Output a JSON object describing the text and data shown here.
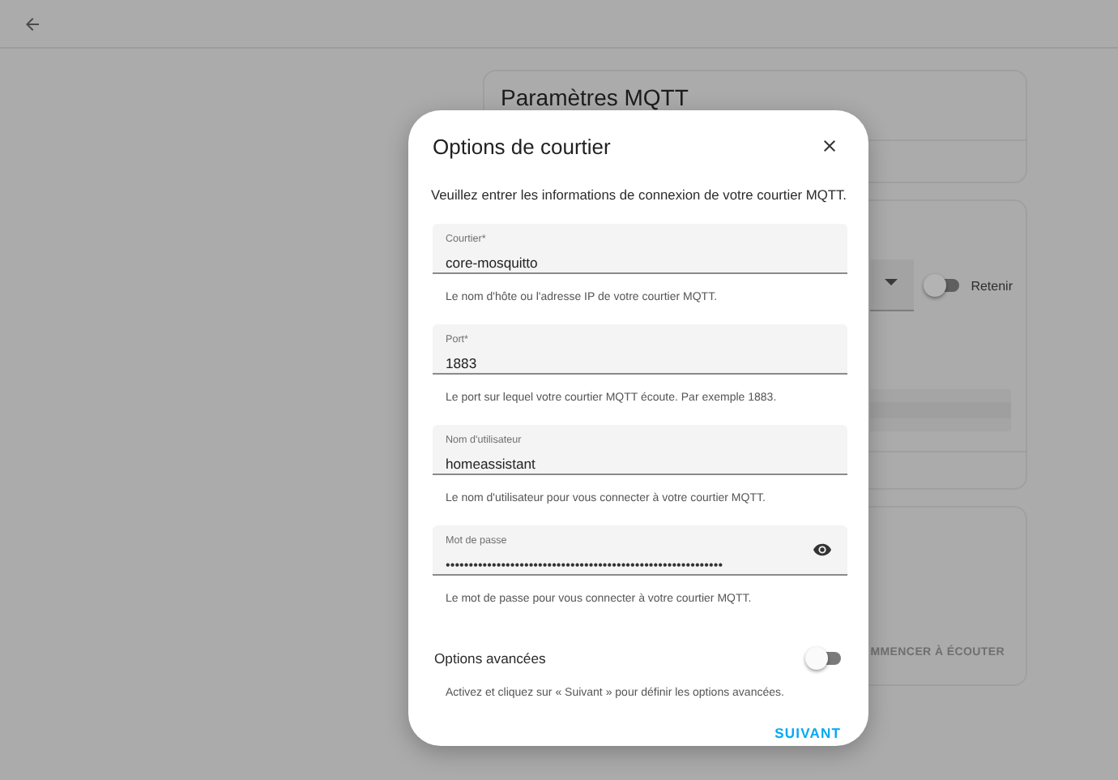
{
  "background": {
    "cards": [
      {
        "kind": "title",
        "title": "Paramètres MQTT"
      },
      {
        "kind": "listen_form",
        "toggle_label": "Retenir",
        "toggle_on": false
      },
      {
        "kind": "action",
        "button": "MMENCER À ÉCOUTER"
      }
    ]
  },
  "dialog": {
    "title": "Options de courtier",
    "description": "Veuillez entrer les informations de connexion de votre courtier MQTT.",
    "fields": [
      {
        "kind": "text",
        "label": "Courtier*",
        "value": "core-mosquitto",
        "helper": "Le nom d'hôte ou l'adresse IP de votre courtier MQTT."
      },
      {
        "kind": "text",
        "label": "Port*",
        "value": "1883",
        "helper": "Le port sur lequel votre courtier MQTT écoute. Par exemple 1883."
      },
      {
        "kind": "text",
        "label": "Nom d'utilisateur",
        "value": "homeassistant",
        "helper": "Le nom d'utilisateur pour vous connecter à votre courtier MQTT."
      },
      {
        "kind": "password",
        "label": "Mot de passe",
        "value": "••••••••••••••••••••••••••••••••••••••••••••••••••••••••••••",
        "helper": "Le mot de passe pour vous connecter à votre courtier MQTT."
      }
    ],
    "advanced": {
      "label": "Options avancées",
      "on": false,
      "helper": "Activez et cliquez sur « Suivant » pour définir les options avancées."
    },
    "button": "SUIVANT"
  }
}
